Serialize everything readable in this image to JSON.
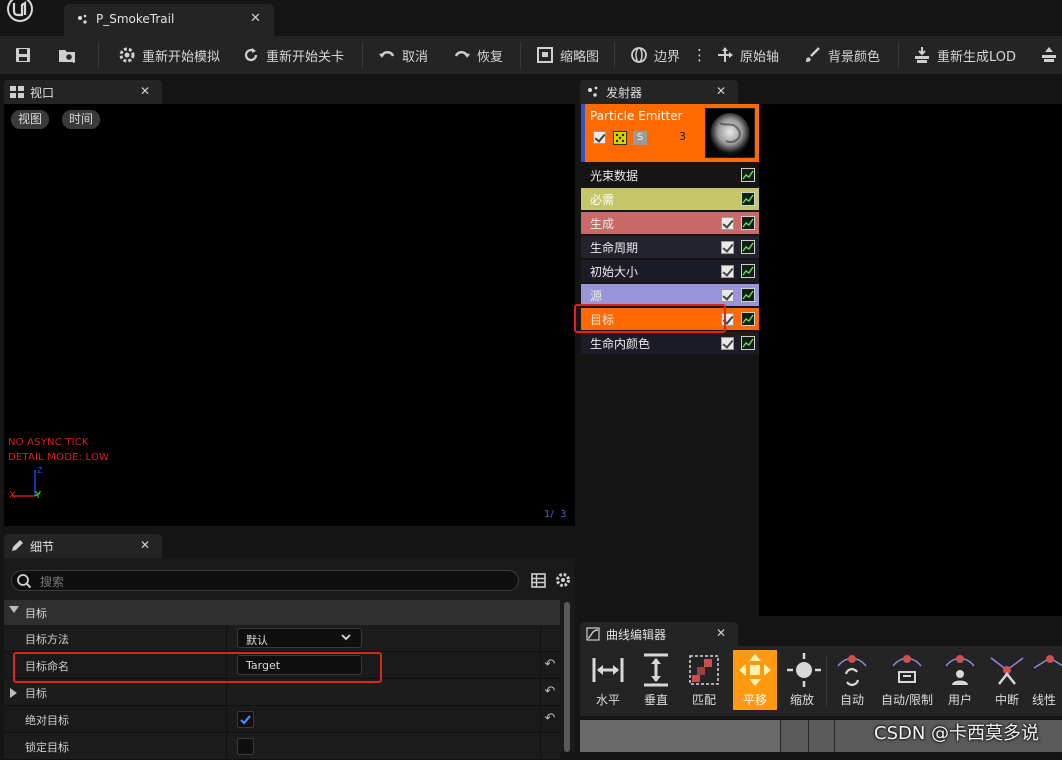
{
  "app": {
    "document_tab": "P_SmokeTrail"
  },
  "toolbar": {
    "restart_sim": "重新开始模拟",
    "restart_level": "重新开始关卡",
    "undo": "取消",
    "redo": "恢复",
    "thumbnail": "缩略图",
    "bounds": "边界",
    "origin_axis": "原始轴",
    "background_color": "背景颜色",
    "regen_lod": "重新生成LOD"
  },
  "viewport": {
    "tab_label": "视口",
    "view_button": "视图",
    "time_button": "时间",
    "debug_line1": "NO ASYNC TICK",
    "debug_line2": "DETAIL MODE: LOW",
    "axis_z": "Z",
    "axis_x": "X",
    "axis_y": "Y",
    "frame_counter": "1/  3"
  },
  "details": {
    "tab_label": "细节",
    "search_placeholder": "搜索",
    "category": "目标",
    "rows": [
      {
        "label": "目标方法",
        "value": "默认"
      },
      {
        "label": "目标命名",
        "value": "Target"
      },
      {
        "label": "目标",
        "value": ""
      },
      {
        "label": "绝对目标",
        "value": "checked"
      },
      {
        "label": "锁定目标",
        "value": "unchecked"
      }
    ]
  },
  "emitters": {
    "tab_label": "发射器",
    "emitter_name": "Particle Emitter",
    "emitter_count": "3",
    "s_badge": "S",
    "modules": [
      {
        "label": "光束数据",
        "color": "#151515"
      },
      {
        "label": "必需",
        "color": "#c5c56a"
      },
      {
        "label": "生成",
        "color": "#c86a6a"
      },
      {
        "label": "生命周期",
        "color": "#23232e"
      },
      {
        "label": "初始大小",
        "color": "#1c1c26"
      },
      {
        "label": "源",
        "color": "#9a95d8"
      },
      {
        "label": "目标",
        "color": "#ff6a00"
      },
      {
        "label": "生命内颜色",
        "color": "#1c1c26"
      }
    ]
  },
  "curve_editor": {
    "tab_label": "曲线编辑器",
    "buttons": [
      "水平",
      "垂直",
      "匹配",
      "平移",
      "缩放",
      "自动",
      "自动/限制",
      "用户",
      "中断",
      "线性"
    ]
  },
  "watermark": "CSDN @卡西莫多说",
  "colors": {
    "accent_orange": "#ff6a00",
    "highlight_box": "#e0231b"
  }
}
